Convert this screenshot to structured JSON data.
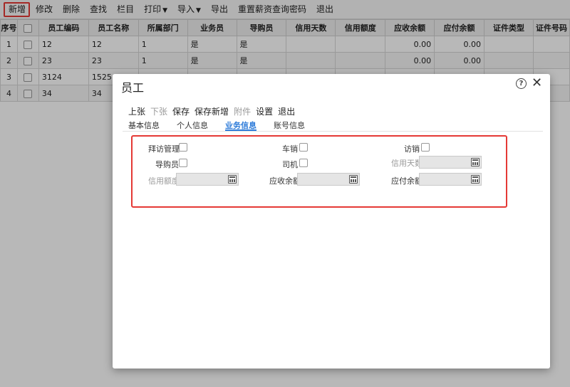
{
  "toolbar": {
    "items": [
      "新增",
      "修改",
      "删除",
      "查找",
      "栏目",
      "打印",
      "导入",
      "导出",
      "重置薪资查询密码",
      "退出"
    ]
  },
  "grid": {
    "headers": [
      "序号",
      "",
      "员工编码",
      "员工名称",
      "所属部门",
      "业务员",
      "导购员",
      "信用天数",
      "信用额度",
      "应收余额",
      "应付余额",
      "证件类型",
      "证件号码"
    ],
    "rows": [
      {
        "no": "1",
        "code": "12",
        "name": "12",
        "dept": "1",
        "salesman": "是",
        "guide": "是",
        "credit_days": "",
        "credit_limit": "",
        "receivable": "0.00",
        "payable": "0.00",
        "id_type": "",
        "id_no": ""
      },
      {
        "no": "2",
        "code": "23",
        "name": "23",
        "dept": "1",
        "salesman": "是",
        "guide": "是",
        "credit_days": "",
        "credit_limit": "",
        "receivable": "0.00",
        "payable": "0.00",
        "id_type": "",
        "id_no": ""
      },
      {
        "no": "3",
        "code": "3124",
        "name": "1525",
        "dept": "",
        "salesman": "",
        "guide": "",
        "credit_days": "",
        "credit_limit": "",
        "receivable": "",
        "payable": "",
        "id_type": "",
        "id_no": ""
      },
      {
        "no": "4",
        "code": "34",
        "name": "34",
        "dept": "",
        "salesman": "",
        "guide": "",
        "credit_days": "",
        "credit_limit": "",
        "receivable": "",
        "payable": "",
        "id_type": "",
        "id_no": ""
      }
    ]
  },
  "dialog": {
    "title": "员工",
    "help_glyph": "?",
    "close_glyph": "✕",
    "actions": [
      "上张",
      "下张",
      "保存",
      "保存新增",
      "附件",
      "设置",
      "退出"
    ],
    "tabs": [
      "基本信息",
      "个人信息",
      "业务信息",
      "账号信息"
    ],
    "active_tab": "业务信息",
    "fields": {
      "visit_mgmt": "拜访管理",
      "car_sales": "车销",
      "visit_sales": "访销",
      "shopping_guide": "导购员",
      "driver": "司机",
      "credit_days": "信用天数",
      "credit_limit": "信用额度",
      "receivable": "应收余额",
      "payable": "应付余额"
    }
  },
  "colors": {
    "highlight": "#e53935",
    "active_tab": "#2d7bd9"
  }
}
